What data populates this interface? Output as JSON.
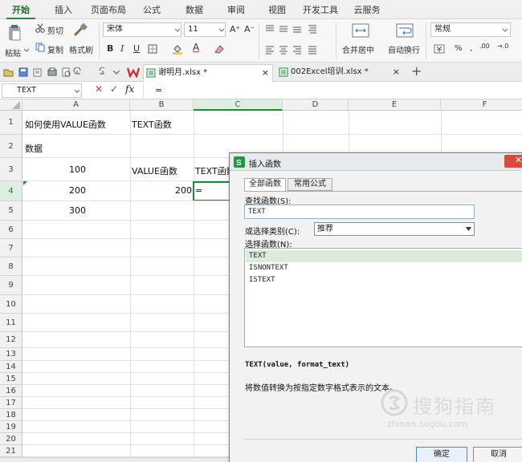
{
  "ribbon_tabs": [
    "开始",
    "插入",
    "页面布局",
    "公式",
    "数据",
    "审阅",
    "视图",
    "开发工具",
    "云服务"
  ],
  "ribbon": {
    "paste": "粘贴",
    "cut": "剪切",
    "copy": "复制",
    "format_painter": "格式刷",
    "font_name": "宋体",
    "font_size": "11",
    "merge_center": "合并居中",
    "wrap_text": "自动换行",
    "number_format": "常规",
    "percent": "%",
    "comma": ",",
    "inc_decimal": ".00",
    "dec_decimal": "→.0"
  },
  "file_tabs": [
    {
      "label": "谢明月.xlsx *",
      "active": true
    },
    {
      "label": "002Excel培训.xlsx *",
      "active": false
    }
  ],
  "formula_bar": {
    "name_box": "TEXT",
    "cancel": "✕",
    "confirm": "✓",
    "fx": "fx",
    "value": "="
  },
  "columns": [
    "A",
    "B",
    "C",
    "D",
    "E",
    "F"
  ],
  "rows": [
    "1",
    "2",
    "3",
    "4",
    "5",
    "6",
    "7",
    "8",
    "9",
    "10",
    "11",
    "12",
    "13",
    "14",
    "15",
    "16",
    "17",
    "18",
    "19",
    "20",
    "21"
  ],
  "cells": {
    "A1": "如何使用VALUE函数",
    "B1": "TEXT函数",
    "A2": "数据",
    "A3": "100",
    "B3": "VALUE函数",
    "C3": "TEXT函数",
    "A4": "200",
    "B4": "200",
    "C4": "=",
    "A5": "300"
  },
  "dialog": {
    "title": "插入函数",
    "tab_all": "全部函数",
    "tab_common": "常用公式",
    "search_label": "查找函数(S):",
    "search_value": "TEXT",
    "category_label": "或选择类别(C):",
    "category_value": "推荐",
    "select_label": "选择函数(N):",
    "functions": [
      "TEXT",
      "ISNONTEXT",
      "ISTEXT"
    ],
    "signature": "TEXT(value, format_text)",
    "description": "将数值转换为按指定数字格式表示的文本。",
    "ok": "确定",
    "cancel": "取消",
    "watermark": "搜狗指南",
    "watermark_url": "zhinan.sogou.com"
  },
  "colors": {
    "accent": "#1e8a3c",
    "selected_row": "#dcecda"
  }
}
